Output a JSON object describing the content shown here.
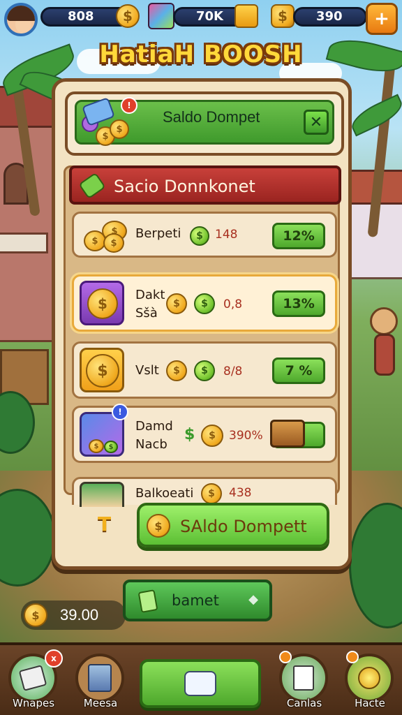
{
  "hud": {
    "gold_value": "808",
    "gems_value": "70K",
    "chest_value": "390",
    "plus_label": "+",
    "colors": {
      "bar": "#1a2748",
      "gold": "#f0a91e"
    }
  },
  "title": "HatiaH BOOSH",
  "header": {
    "title": "Saldo Dompet",
    "close_symbol": "✕",
    "badge_symbol": "!"
  },
  "ribbon": {
    "text": "Sacio Donnkonet"
  },
  "rows": [
    {
      "label_line1": "Berpeti",
      "label_line2": "",
      "value": "148",
      "percent": "12%"
    },
    {
      "label_line1": "Dakt",
      "label_line2": "Sšà",
      "value": "0,8",
      "percent": "13%"
    },
    {
      "label_line1": "Vslt",
      "label_line2": "",
      "value": "8/8",
      "percent": "7 %"
    },
    {
      "label_line1": "Damd",
      "label_line2": "Nacb",
      "value": "390%",
      "percent": ""
    },
    {
      "label_line1": "Balkoeati",
      "label_line2": "",
      "value": "438",
      "percent": ""
    }
  ],
  "currency_symbol": "$",
  "small_t": "T",
  "main_button": {
    "label": "SAldo Dompett"
  },
  "secondary_button": {
    "label": "bamet",
    "chevron": "◆"
  },
  "coins_pill": {
    "value": "39.00"
  },
  "bottom_nav": [
    {
      "label": "Wnapes",
      "icon": "map-icon"
    },
    {
      "label": "Meesa",
      "icon": "book-icon"
    },
    {
      "label": "",
      "icon": "star-icon"
    },
    {
      "label": "Canlas",
      "icon": "list-icon"
    },
    {
      "label": "Hacte",
      "icon": "gem-icon"
    }
  ],
  "badge_x": "x"
}
